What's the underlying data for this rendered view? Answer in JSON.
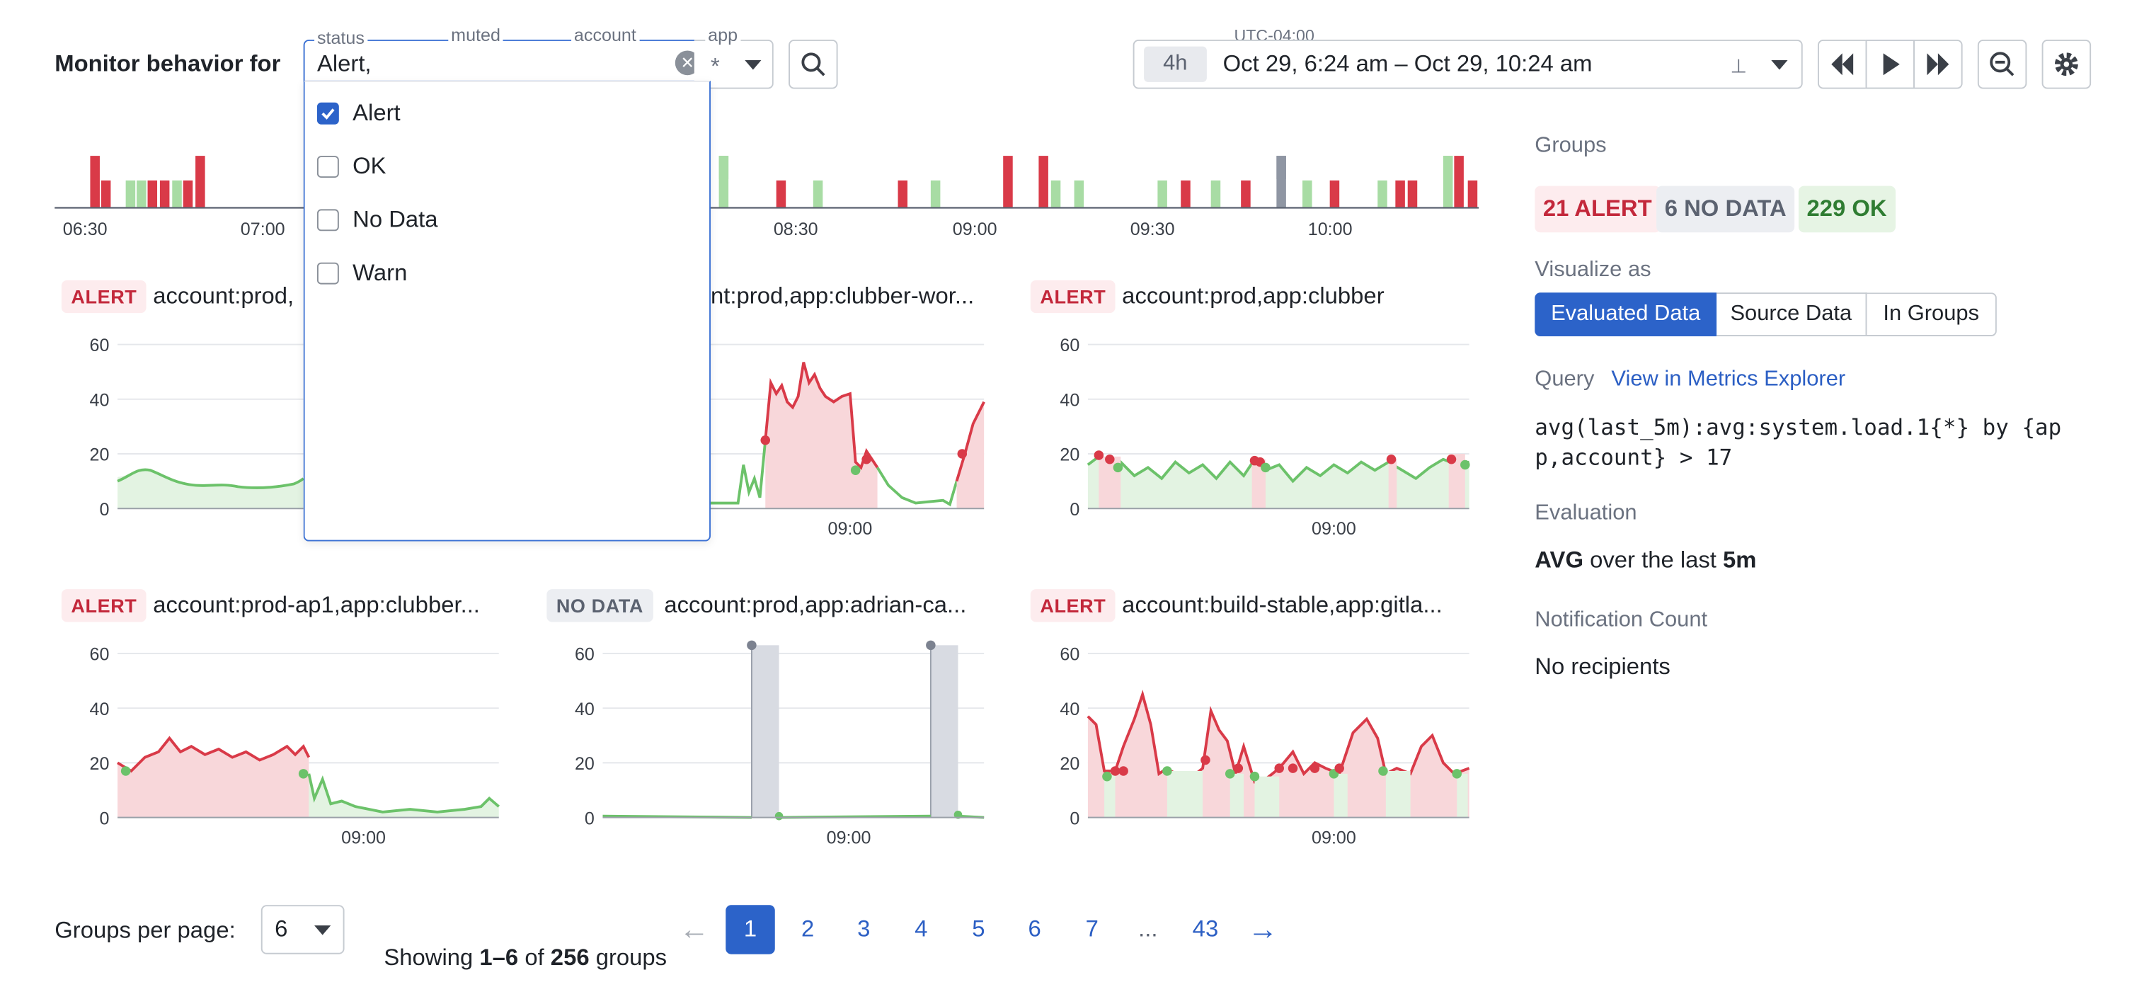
{
  "header": {
    "title": "Monitor behavior for",
    "filters": {
      "status": {
        "label": "status",
        "value": "Alert,"
      },
      "muted": {
        "label": "muted"
      },
      "account": {
        "label": "account"
      },
      "app": {
        "label": "app",
        "value": "*"
      }
    },
    "timezone": "UTC-04:00",
    "range_badge": "4h",
    "time_range": "Oct 29, 6:24 am – Oct 29, 10:24 am"
  },
  "status_menu": {
    "options": [
      {
        "label": "Alert",
        "checked": true
      },
      {
        "label": "OK",
        "checked": false
      },
      {
        "label": "No Data",
        "checked": false
      },
      {
        "label": "Warn",
        "checked": false
      }
    ]
  },
  "timeline": {
    "ticks_left": [
      "06:30",
      "07:00"
    ],
    "ticks_right": [
      "08:30",
      "09:00",
      "09:30",
      "10:00"
    ]
  },
  "panels": [
    {
      "status": "ALERT",
      "status_class": "alert",
      "title": "account:prod,",
      "yticks": [
        "60",
        "40",
        "20",
        "0"
      ],
      "xtick": ""
    },
    {
      "status": "",
      "status_class": "",
      "title": "nt:prod,app:clubber-wor...",
      "yticks": [],
      "xtick": "09:00"
    },
    {
      "status": "ALERT",
      "status_class": "alert",
      "title": "account:prod,app:clubber",
      "yticks": [
        "60",
        "40",
        "20",
        "0"
      ],
      "xtick": "09:00"
    },
    {
      "status": "ALERT",
      "status_class": "alert",
      "title": "account:prod-ap1,app:clubber...",
      "yticks": [
        "60",
        "40",
        "20",
        "0"
      ],
      "xtick": "09:00"
    },
    {
      "status": "NO DATA",
      "status_class": "nodata",
      "title": "account:prod,app:adrian-ca...",
      "yticks": [
        "60",
        "40",
        "20",
        "0"
      ],
      "xtick": "09:00"
    },
    {
      "status": "ALERT",
      "status_class": "alert",
      "title": "account:build-stable,app:gitla...",
      "yticks": [
        "60",
        "40",
        "20",
        "0"
      ],
      "xtick": "09:00"
    }
  ],
  "sidebar": {
    "groups_label": "Groups",
    "counts": {
      "alert": "21 ALERT",
      "nodata": "6 NO DATA",
      "ok": "229 OK"
    },
    "visualize_label": "Visualize as",
    "visualize_options": [
      "Evaluated Data",
      "Source Data",
      "In Groups"
    ],
    "query_label": "Query",
    "query_link": "View in Metrics Explorer",
    "query_line1": "avg(last_5m):avg:system.load.1{*} by {ap",
    "query_line2": "p,account} > 17",
    "evaluation_label": "Evaluation",
    "evaluation_strong1": "AVG",
    "evaluation_mid": " over the last ",
    "evaluation_strong2": "5m",
    "notification_label": "Notification Count",
    "notification_value": "No recipients"
  },
  "pagination": {
    "per_page_label": "Groups per page:",
    "per_page_value": "6",
    "showing_prefix": "Showing ",
    "showing_range": "1–6",
    "showing_of": " of ",
    "showing_total": "256",
    "showing_suffix": " groups",
    "pages": [
      "1",
      "2",
      "3",
      "4",
      "5",
      "6",
      "7",
      "...",
      "43"
    ],
    "current": "1"
  },
  "colors": {
    "alert": "#d93a48",
    "ok": "#6cc26a",
    "nodata": "#8f96a3",
    "accent": "#2c63c9"
  }
}
